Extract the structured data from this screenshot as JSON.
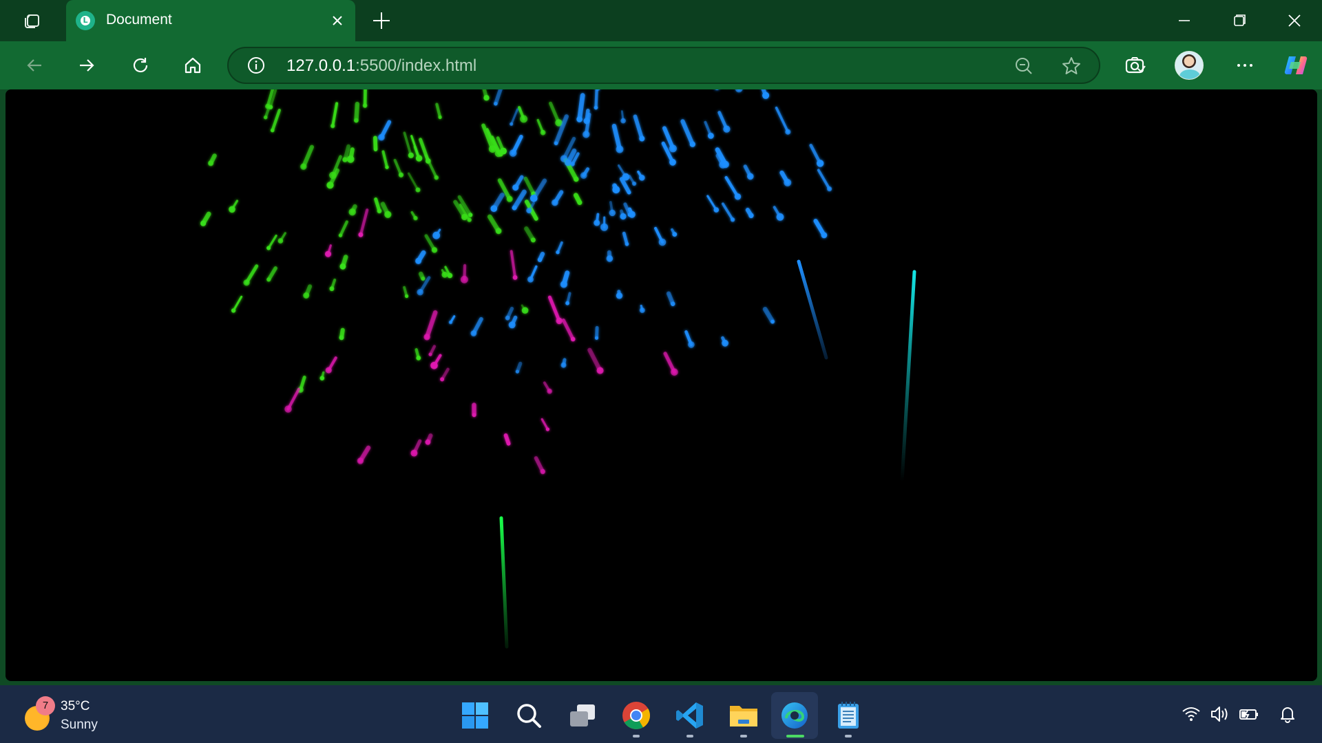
{
  "browser": {
    "tab": {
      "title": "Document",
      "favicon": "live-server-icon"
    },
    "address": {
      "host": "127.0.0.1",
      "rest": ":5500/index.html"
    },
    "icons": {
      "tab_actions": "tab-actions-icon",
      "new_tab": "plus-icon",
      "back": "back-arrow-icon",
      "forward": "forward-arrow-icon",
      "refresh": "refresh-icon",
      "home": "home-icon",
      "info": "info-icon",
      "zoom": "zoom-out-icon",
      "favorite": "star-icon",
      "screenshot": "screenshot-icon",
      "more": "more-icon",
      "copilot": "copilot-icon"
    },
    "colors": {
      "titlebar": "#0c3f1f",
      "toolbar": "#126a32",
      "viewport": "#000000"
    }
  },
  "taskbar": {
    "weather": {
      "badge": "7",
      "temp": "35°C",
      "condition": "Sunny"
    },
    "apps": [
      "start",
      "search",
      "task-view",
      "chrome",
      "vscode",
      "file-explorer",
      "edge",
      "notepad"
    ],
    "active_app": "edge",
    "tray": [
      "wifi-icon",
      "volume-icon",
      "battery-icon",
      "notification-bell-icon"
    ]
  },
  "fireworks": {
    "colors": {
      "green": "#39e01a",
      "blue": "#1e8fff",
      "magenta": "#e01ab0",
      "cyan": "#14e6e6",
      "lime": "#19ff4a"
    }
  }
}
